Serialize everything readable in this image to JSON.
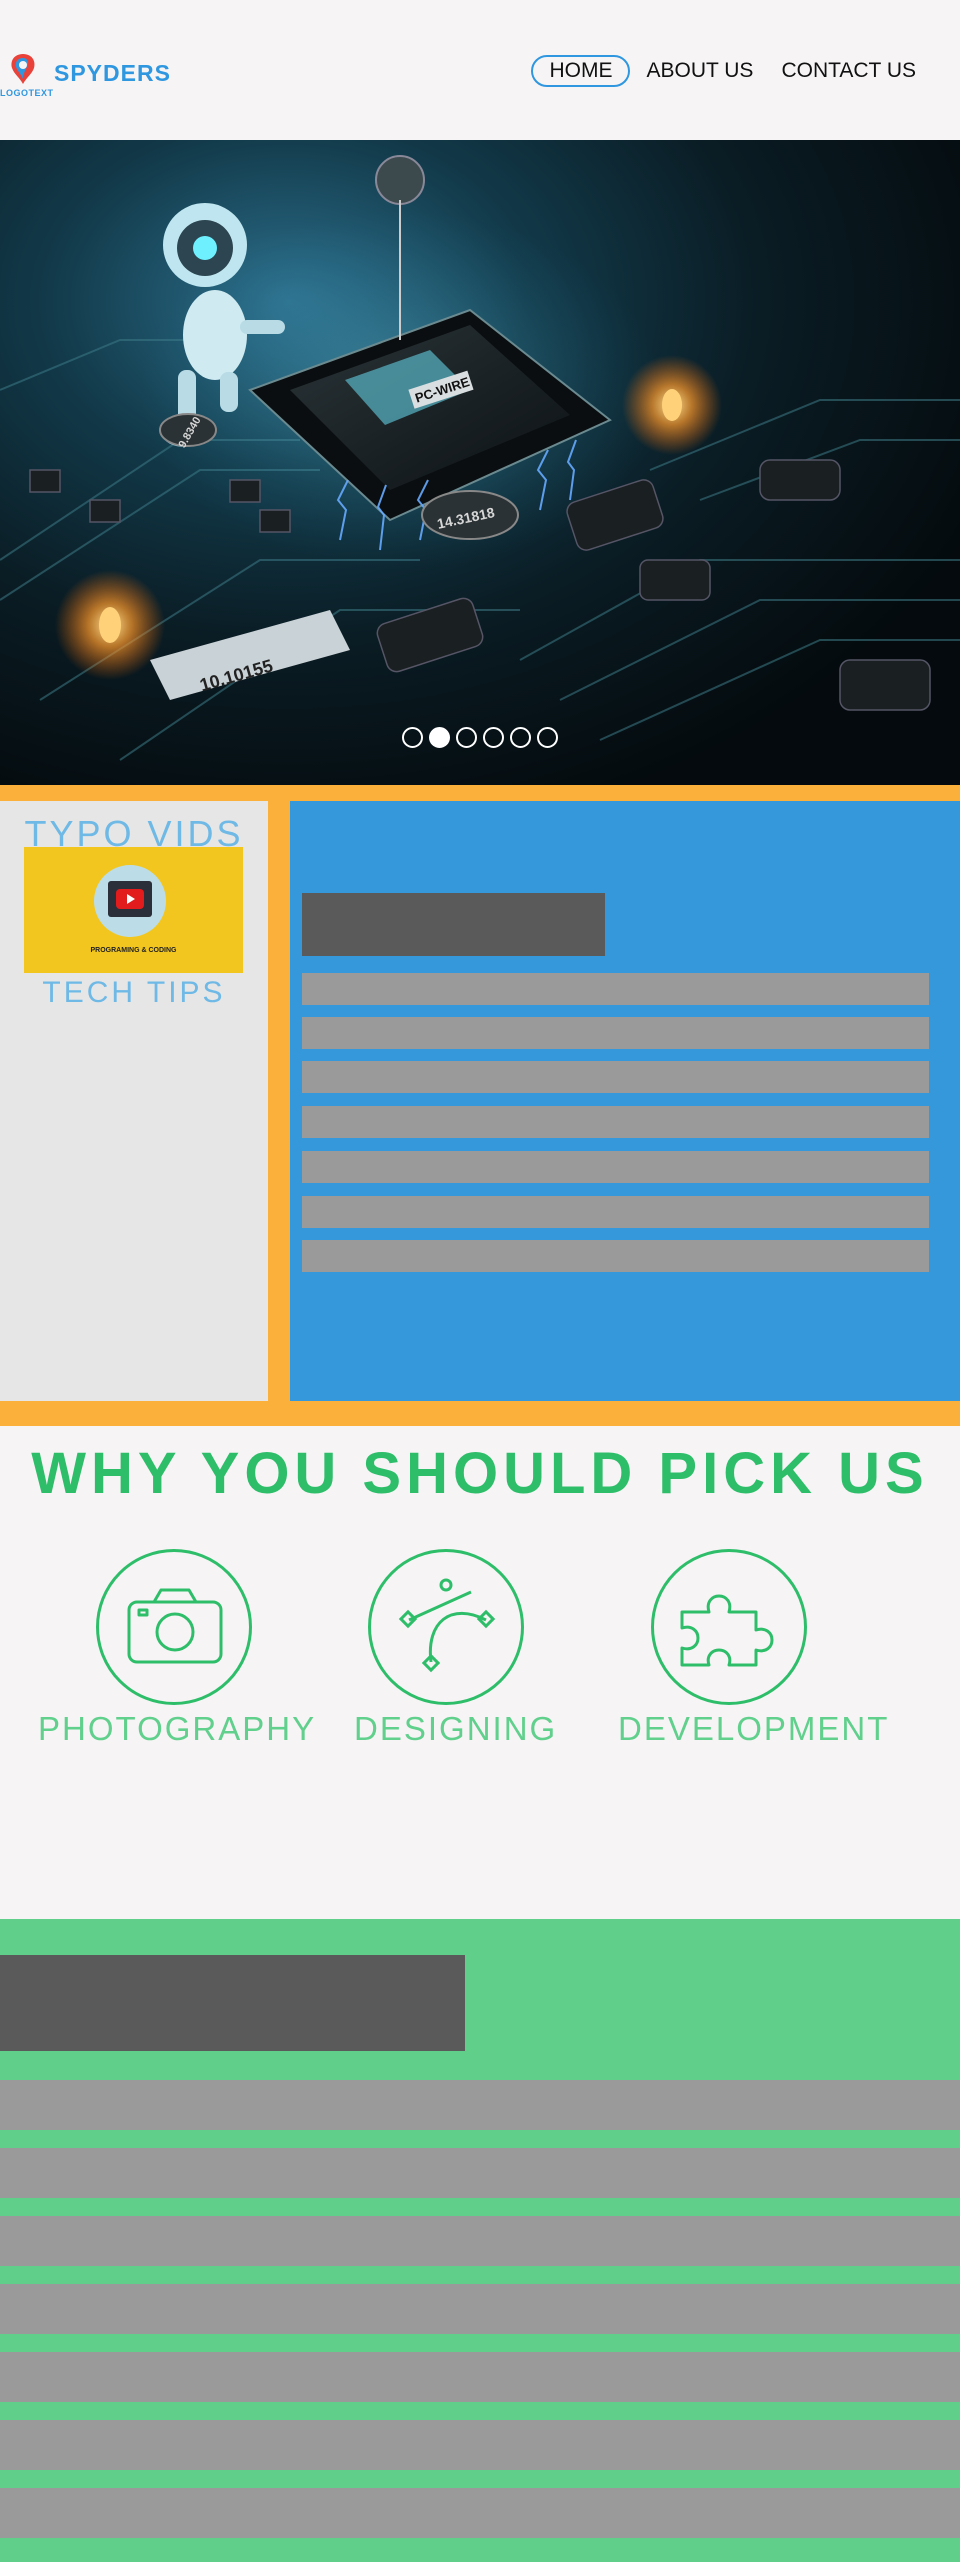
{
  "header": {
    "logo_text": "SPYDERS",
    "logo_subtext": "LOGOTEXT",
    "nav": [
      {
        "label": "HOME",
        "active": true
      },
      {
        "label": "ABOUT US",
        "active": false
      },
      {
        "label": "CONTACT US",
        "active": false
      }
    ]
  },
  "hero": {
    "chip_labels": [
      "PC-WIRE",
      "14.31818",
      "10.10155",
      "9.8340"
    ],
    "slides_total": 6,
    "active_slide": 2
  },
  "sidebar": {
    "title": "TYPO VIDS",
    "video_caption": "PROGRAMING & CODING",
    "subtitle": "TECH TIPS"
  },
  "why": {
    "title": "WHY YOU SHOULD PICK US",
    "features": [
      {
        "label": "PHOTOGRAPHY",
        "icon": "camera-icon"
      },
      {
        "label": "DESIGNING",
        "icon": "bezier-curve-icon"
      },
      {
        "label": "DEVELOPMENT",
        "icon": "puzzle-icon"
      }
    ]
  },
  "colors": {
    "brand_blue": "#2f97e0",
    "orange": "#fbb03b",
    "panel_blue": "#3498db",
    "green_text": "#2ebe6a",
    "green_bg": "#5fcf8a"
  }
}
